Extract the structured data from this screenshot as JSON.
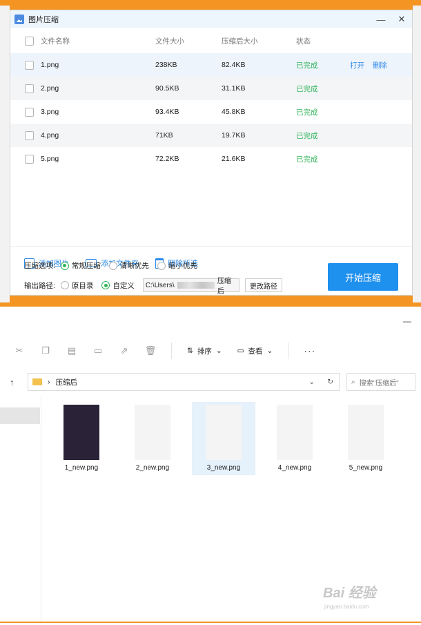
{
  "dialog": {
    "title": "图片压缩",
    "header": {
      "name": "文件名称",
      "size": "文件大小",
      "compressed": "压缩后大小",
      "status": "状态"
    },
    "rows": [
      {
        "name": "1.png",
        "size": "238KB",
        "compressed": "82.4KB",
        "status": "已完成",
        "open": "打开",
        "delete": "删除"
      },
      {
        "name": "2.png",
        "size": "90.5KB",
        "compressed": "31.1KB",
        "status": "已完成"
      },
      {
        "name": "3.png",
        "size": "93.4KB",
        "compressed": "45.8KB",
        "status": "已完成"
      },
      {
        "name": "4.png",
        "size": "71KB",
        "compressed": "19.7KB",
        "status": "已完成"
      },
      {
        "name": "5.png",
        "size": "72.2KB",
        "compressed": "21.6KB",
        "status": "已完成"
      }
    ],
    "toolbar": {
      "add_image": "添加图片",
      "add_folder": "添加文件夹",
      "delete_selected": "删除所选"
    },
    "options": {
      "label": "压缩选项:",
      "choices": [
        "常规压缩",
        "清晰优先",
        "缩小优先"
      ],
      "selected": "常规压缩"
    },
    "output": {
      "label": "输出路径:",
      "choices": [
        "原目录",
        "自定义"
      ],
      "selected": "自定义",
      "path_prefix": "C:\\Users\\",
      "path_suffix": "压缩后",
      "change_btn": "更改路径"
    },
    "start_btn": "开始压缩"
  },
  "explorer": {
    "sort_label": "排序",
    "view_label": "查看",
    "more_label": "···",
    "breadcrumb": "压缩后",
    "search_placeholder": "搜索\"压缩后\"",
    "files": [
      "1_new.png",
      "2_new.png",
      "3_new.png",
      "4_new.png",
      "5_new.png"
    ],
    "selected_file": "3_new.png"
  },
  "watermark": {
    "main": "Bai 经验",
    "sub": "jingyan.baidu.com"
  },
  "colors": {
    "accent": "#1e90ee",
    "success": "#2fb45a",
    "link": "#2d8ae8",
    "frame": "#f39423"
  }
}
